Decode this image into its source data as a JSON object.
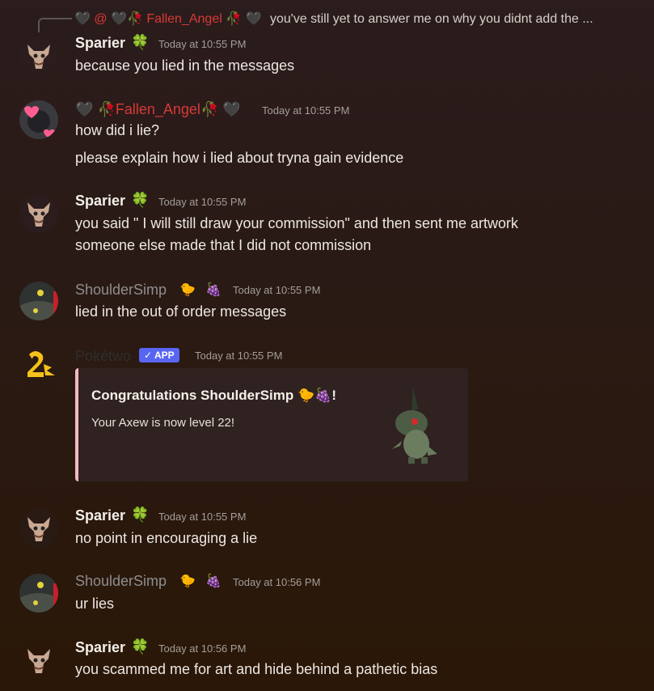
{
  "reply": {
    "username": "Fallen_Angel",
    "text": "you've still yet to answer me on why you didnt add the ..."
  },
  "messages": [
    {
      "username": "Sparier",
      "time": "Today at 10:55 PM",
      "lines": [
        "because you lied in the messages"
      ]
    },
    {
      "username": "Fallen_Angel",
      "time": "Today at 10:55 PM",
      "lines": [
        "how did i lie?",
        "please explain how i lied about tryna gain evidence"
      ]
    },
    {
      "username": "Sparier",
      "time": "Today at 10:55 PM",
      "lines": [
        "you said \" I will still draw your commission\" and then sent me artwork",
        "someone else made that I did not commission"
      ]
    },
    {
      "username": "ShoulderSimp",
      "time": "Today at 10:55 PM",
      "lines": [
        "lied in the out of order messages"
      ]
    },
    {
      "username": "Pokétwo",
      "badge": "APP",
      "time": "Today at 10:55 PM",
      "embed": {
        "title": "Congratulations ShoulderSimp",
        "description": "Your Axew is now level 22!",
        "accent": "#f4b8c0"
      }
    },
    {
      "username": "Sparier",
      "time": "Today at 10:55 PM",
      "lines": [
        "no point in encouraging a lie"
      ]
    },
    {
      "username": "ShoulderSimp",
      "time": "Today at 10:56 PM",
      "lines": [
        "ur lies"
      ]
    },
    {
      "username": "Sparier",
      "time": "Today at 10:56 PM",
      "lines": [
        "you scammed me for art and hide behind a pathetic bias"
      ]
    }
  ],
  "colors": {
    "sparier": "#f2efe9",
    "fallen": "#d63a36",
    "shoulder": "#8e8e8e",
    "poketwo": "#2e2e2e",
    "app_badge": "#5865f2"
  }
}
